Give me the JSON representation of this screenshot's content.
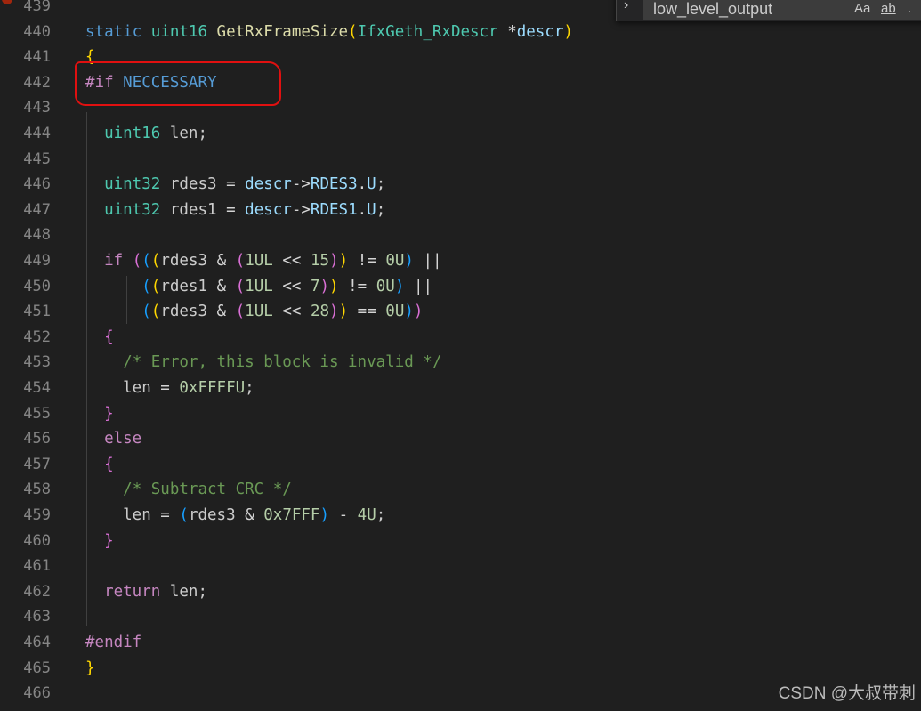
{
  "find_widget": {
    "query": "low_level_output",
    "match_case_label": "Aa",
    "whole_word_label": "ab"
  },
  "editor": {
    "lines": [
      {
        "num": "439",
        "tokens": []
      },
      {
        "num": "440",
        "tokens": [
          [
            "kw",
            "static"
          ],
          [
            "id",
            " "
          ],
          [
            "type",
            "uint16"
          ],
          [
            "id",
            " "
          ],
          [
            "fn",
            "GetRxFrameSize"
          ],
          [
            "b1",
            "("
          ],
          [
            "type",
            "IfxGeth_RxDescr"
          ],
          [
            "id",
            " "
          ],
          [
            "op",
            "*"
          ],
          [
            "param",
            "descr"
          ],
          [
            "b1",
            ")"
          ]
        ]
      },
      {
        "num": "441",
        "tokens": [
          [
            "b1",
            "{"
          ]
        ]
      },
      {
        "num": "442",
        "tokens": [
          [
            "pre",
            "#if"
          ],
          [
            "id",
            " "
          ],
          [
            "macro",
            "NECCESSARY"
          ]
        ]
      },
      {
        "num": "443",
        "tokens": []
      },
      {
        "num": "444",
        "tokens": [
          [
            "id",
            "  "
          ],
          [
            "type",
            "uint16"
          ],
          [
            "id",
            " len;"
          ]
        ]
      },
      {
        "num": "445",
        "tokens": []
      },
      {
        "num": "446",
        "tokens": [
          [
            "id",
            "  "
          ],
          [
            "type",
            "uint32"
          ],
          [
            "id",
            " rdes3 "
          ],
          [
            "op",
            "="
          ],
          [
            "id",
            " "
          ],
          [
            "param",
            "descr"
          ],
          [
            "op",
            "->"
          ],
          [
            "mem",
            "RDES3"
          ],
          [
            "op",
            "."
          ],
          [
            "mem",
            "U"
          ],
          [
            "id",
            ";"
          ]
        ]
      },
      {
        "num": "447",
        "tokens": [
          [
            "id",
            "  "
          ],
          [
            "type",
            "uint32"
          ],
          [
            "id",
            " rdes1 "
          ],
          [
            "op",
            "="
          ],
          [
            "id",
            " "
          ],
          [
            "param",
            "descr"
          ],
          [
            "op",
            "->"
          ],
          [
            "mem",
            "RDES1"
          ],
          [
            "op",
            "."
          ],
          [
            "mem",
            "U"
          ],
          [
            "id",
            ";"
          ]
        ]
      },
      {
        "num": "448",
        "tokens": []
      },
      {
        "num": "449",
        "tokens": [
          [
            "id",
            "  "
          ],
          [
            "ctl",
            "if"
          ],
          [
            "id",
            " "
          ],
          [
            "b2",
            "("
          ],
          [
            "b3",
            "("
          ],
          [
            "b1",
            "("
          ],
          [
            "id",
            "rdes3 "
          ],
          [
            "op",
            "&"
          ],
          [
            "id",
            " "
          ],
          [
            "b2",
            "("
          ],
          [
            "num",
            "1UL"
          ],
          [
            "id",
            " "
          ],
          [
            "op",
            "<<"
          ],
          [
            "id",
            " "
          ],
          [
            "num",
            "15"
          ],
          [
            "b2",
            ")"
          ],
          [
            "b1",
            ")"
          ],
          [
            "id",
            " "
          ],
          [
            "op",
            "!="
          ],
          [
            "id",
            " "
          ],
          [
            "num",
            "0U"
          ],
          [
            "b3",
            ")"
          ],
          [
            "id",
            " "
          ],
          [
            "op",
            "||"
          ]
        ]
      },
      {
        "num": "450",
        "tokens": [
          [
            "id",
            "      "
          ],
          [
            "b3",
            "("
          ],
          [
            "b1",
            "("
          ],
          [
            "id",
            "rdes1 "
          ],
          [
            "op",
            "&"
          ],
          [
            "id",
            " "
          ],
          [
            "b2",
            "("
          ],
          [
            "num",
            "1UL"
          ],
          [
            "id",
            " "
          ],
          [
            "op",
            "<<"
          ],
          [
            "id",
            " "
          ],
          [
            "num",
            "7"
          ],
          [
            "b2",
            ")"
          ],
          [
            "b1",
            ")"
          ],
          [
            "id",
            " "
          ],
          [
            "op",
            "!="
          ],
          [
            "id",
            " "
          ],
          [
            "num",
            "0U"
          ],
          [
            "b3",
            ")"
          ],
          [
            "id",
            " "
          ],
          [
            "op",
            "||"
          ]
        ]
      },
      {
        "num": "451",
        "tokens": [
          [
            "id",
            "      "
          ],
          [
            "b3",
            "("
          ],
          [
            "b1",
            "("
          ],
          [
            "id",
            "rdes3 "
          ],
          [
            "op",
            "&"
          ],
          [
            "id",
            " "
          ],
          [
            "b2",
            "("
          ],
          [
            "num",
            "1UL"
          ],
          [
            "id",
            " "
          ],
          [
            "op",
            "<<"
          ],
          [
            "id",
            " "
          ],
          [
            "num",
            "28"
          ],
          [
            "b2",
            ")"
          ],
          [
            "b1",
            ")"
          ],
          [
            "id",
            " "
          ],
          [
            "op",
            "=="
          ],
          [
            "id",
            " "
          ],
          [
            "num",
            "0U"
          ],
          [
            "b3",
            ")"
          ],
          [
            "b2",
            ")"
          ]
        ]
      },
      {
        "num": "452",
        "tokens": [
          [
            "id",
            "  "
          ],
          [
            "b2",
            "{"
          ]
        ]
      },
      {
        "num": "453",
        "tokens": [
          [
            "id",
            "    "
          ],
          [
            "cmt",
            "/* Error, this block is invalid */"
          ]
        ]
      },
      {
        "num": "454",
        "tokens": [
          [
            "id",
            "    len "
          ],
          [
            "op",
            "="
          ],
          [
            "id",
            " "
          ],
          [
            "num",
            "0xFFFFU"
          ],
          [
            "id",
            ";"
          ]
        ]
      },
      {
        "num": "455",
        "tokens": [
          [
            "id",
            "  "
          ],
          [
            "b2",
            "}"
          ]
        ]
      },
      {
        "num": "456",
        "tokens": [
          [
            "id",
            "  "
          ],
          [
            "ctl",
            "else"
          ]
        ]
      },
      {
        "num": "457",
        "tokens": [
          [
            "id",
            "  "
          ],
          [
            "b2",
            "{"
          ]
        ]
      },
      {
        "num": "458",
        "tokens": [
          [
            "id",
            "    "
          ],
          [
            "cmt",
            "/* Subtract CRC */"
          ]
        ]
      },
      {
        "num": "459",
        "tokens": [
          [
            "id",
            "    len "
          ],
          [
            "op",
            "="
          ],
          [
            "id",
            " "
          ],
          [
            "b3",
            "("
          ],
          [
            "id",
            "rdes3 "
          ],
          [
            "op",
            "&"
          ],
          [
            "id",
            " "
          ],
          [
            "num",
            "0x7FFF"
          ],
          [
            "b3",
            ")"
          ],
          [
            "id",
            " "
          ],
          [
            "op",
            "-"
          ],
          [
            "id",
            " "
          ],
          [
            "num",
            "4U"
          ],
          [
            "id",
            ";"
          ]
        ]
      },
      {
        "num": "460",
        "tokens": [
          [
            "id",
            "  "
          ],
          [
            "b2",
            "}"
          ]
        ]
      },
      {
        "num": "461",
        "tokens": []
      },
      {
        "num": "462",
        "tokens": [
          [
            "id",
            "  "
          ],
          [
            "ctl",
            "return"
          ],
          [
            "id",
            " len;"
          ]
        ]
      },
      {
        "num": "463",
        "tokens": []
      },
      {
        "num": "464",
        "tokens": [
          [
            "pre",
            "#endif"
          ]
        ]
      },
      {
        "num": "465",
        "tokens": [
          [
            "b1",
            "}"
          ]
        ]
      },
      {
        "num": "466",
        "tokens": []
      }
    ]
  },
  "watermark": "CSDN @大叔带刺"
}
